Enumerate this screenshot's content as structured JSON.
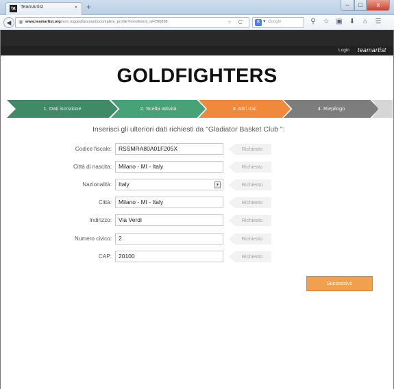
{
  "browser": {
    "tab_title": "TeamArtist",
    "tab_favicon_letter": "ta",
    "tab_close": "×",
    "tab_new": "+",
    "win_min": "–",
    "win_max": "□",
    "win_close": "x",
    "url_domain": "www.teamartist.org",
    "url_path": "/non_logged/accounts/complete_profile?enrollment_id=206898",
    "search_placeholder": "Google",
    "search_engine_letter": "8"
  },
  "site": {
    "login": "Login",
    "brand": "teamartist"
  },
  "page": {
    "title": "GOLDFIGHTERS",
    "intro": "Inserisci gli ulteriori dati richiesti da \"Gladiator Basket Club \":"
  },
  "steps": [
    {
      "label": "1. Dati iscrizione"
    },
    {
      "label": "2. Scelta attività"
    },
    {
      "label": "3. Altri dati"
    },
    {
      "label": "4. Riepilogo"
    }
  ],
  "form": {
    "required_label": "Richiesto",
    "fields": [
      {
        "label": "Codice fiscale:",
        "value": "RSSMRA80A01F205X"
      },
      {
        "label": "Città di nascita:",
        "value": "Milano - MI - Italy"
      },
      {
        "label": "Nazionalità:",
        "value": "Italy"
      },
      {
        "label": "Città:",
        "value": "Milano - MI - Italy"
      },
      {
        "label": "Indirizzo:",
        "value": "Via Verdi"
      },
      {
        "label": "Numero civico:",
        "value": "2"
      },
      {
        "label": "CAP:",
        "value": "20100"
      }
    ],
    "next_label": "Successivo"
  },
  "colors": {
    "step_done": "#3f8a67",
    "step_done_2": "#48a277",
    "step_active": "#f0893c",
    "step_todo": "#7d7d7d",
    "accent_button": "#f0a04f"
  }
}
